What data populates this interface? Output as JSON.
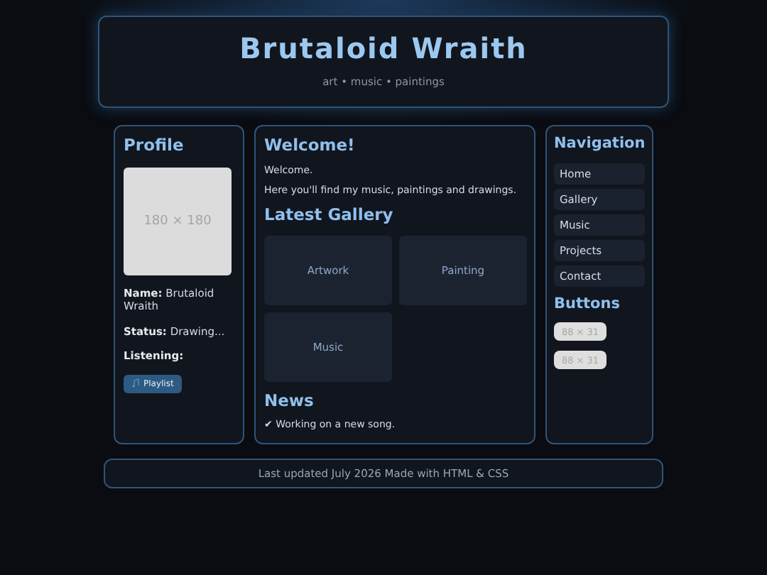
{
  "header": {
    "title": "Brutaloid Wraith",
    "tagline": "art • music • paintings"
  },
  "profile": {
    "heading": "Profile",
    "avatar_placeholder": "180 × 180",
    "fields": [
      {
        "label": "Name:",
        "value": "Brutaloid Wraith"
      },
      {
        "label": "Status:",
        "value": "Drawing..."
      },
      {
        "label": "Listening:"
      }
    ],
    "playlist_button": "Playlist"
  },
  "main": {
    "heading": "Welcome!",
    "paragraphs": [
      "Welcome.",
      "Here you'll find my music, paintings and drawings."
    ],
    "gallery_heading": "Latest Gallery",
    "gallery": [
      "Artwork",
      "Painting",
      "Music"
    ],
    "news_heading": "News",
    "news": [
      "✔ Working on a new song."
    ]
  },
  "navigation": {
    "heading": "Navigation",
    "items": [
      "Home",
      "Gallery",
      "Music",
      "Projects",
      "Contact"
    ],
    "buttons_heading": "Buttons",
    "buttons": [
      "88 × 31",
      "88 × 31"
    ]
  },
  "footer": "Last updated July 2026 Made with HTML & CSS"
}
